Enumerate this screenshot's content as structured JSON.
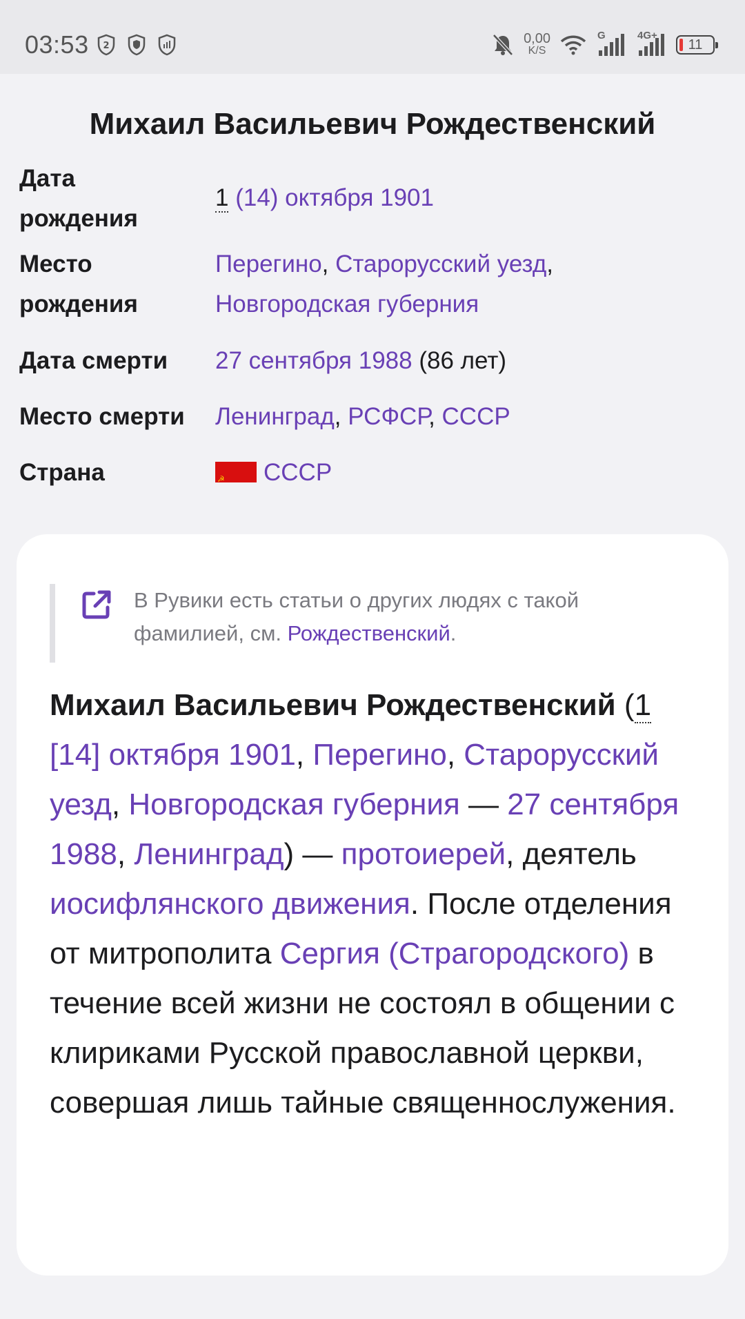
{
  "status_bar": {
    "time": "03:53",
    "net_speed_value": "0,00",
    "net_speed_unit": "K/S",
    "signal1_tag": "G",
    "signal2_tag": "4G+",
    "battery_level": "11"
  },
  "infobox": {
    "title": "Михаил Васильевич Рождественский",
    "birth_date": {
      "label": "Дата рождения",
      "prefix": "1",
      "link": "(14) октября 1901"
    },
    "birth_place": {
      "label": "Место рождения",
      "link1": "Перегино",
      "sep1": ", ",
      "link2": "Старорусский уезд",
      "sep2": ",",
      "link3": "Новгородская губерния"
    },
    "death_date": {
      "label": "Дата смерти",
      "link": "27 сентября 1988",
      "suffix": " (86 лет)"
    },
    "death_place": {
      "label": "Место смерти",
      "link1": "Ленинград",
      "sep1": ", ",
      "link2": "РСФСР",
      "sep2": ", ",
      "link3": "СССР"
    },
    "country": {
      "label": "Страна",
      "link": "СССР"
    }
  },
  "hatnote": {
    "text": "В Рувики есть статьи о других людях с такой фамилией, см. ",
    "link": "Рождественский",
    "end": "."
  },
  "lead": {
    "name": "Михаил Васильевич Рождественский",
    "open": " (",
    "day": "1",
    "date_link": " [14] октября 1901",
    "c1": ", ",
    "place1": "Перегино",
    "c2": ", ",
    "place2": "Старорусский уезд",
    "c3": ", ",
    "place3": "Новгородская губерния",
    "dash1": " — ",
    "death_link": "27 сентября 1988",
    "c4": ", ",
    "death_place": "Ленинград",
    "dash2": ") — ",
    "role_link": "протоиерей",
    "text1": ", деятель ",
    "movement_link": "иосифлянского движения",
    "text2": ". После отделения от митрополита ",
    "sergiy_link": "Сергия (Страгородского)",
    "text3": " в течение всей жизни не состоял в общении с клириками Русской православной церкви, совершая лишь тайные священнослужения."
  },
  "colors": {
    "link": "#6940b5",
    "page_bg": "#f2f2f5",
    "card_bg": "#ffffff"
  },
  "icons": [
    "shield-2-icon",
    "shield-check-icon",
    "shield-signal-icon",
    "bell-off-icon",
    "wifi-icon",
    "cell-signal-icon",
    "battery-icon",
    "external-link-icon",
    "ussr-flag-icon"
  ]
}
